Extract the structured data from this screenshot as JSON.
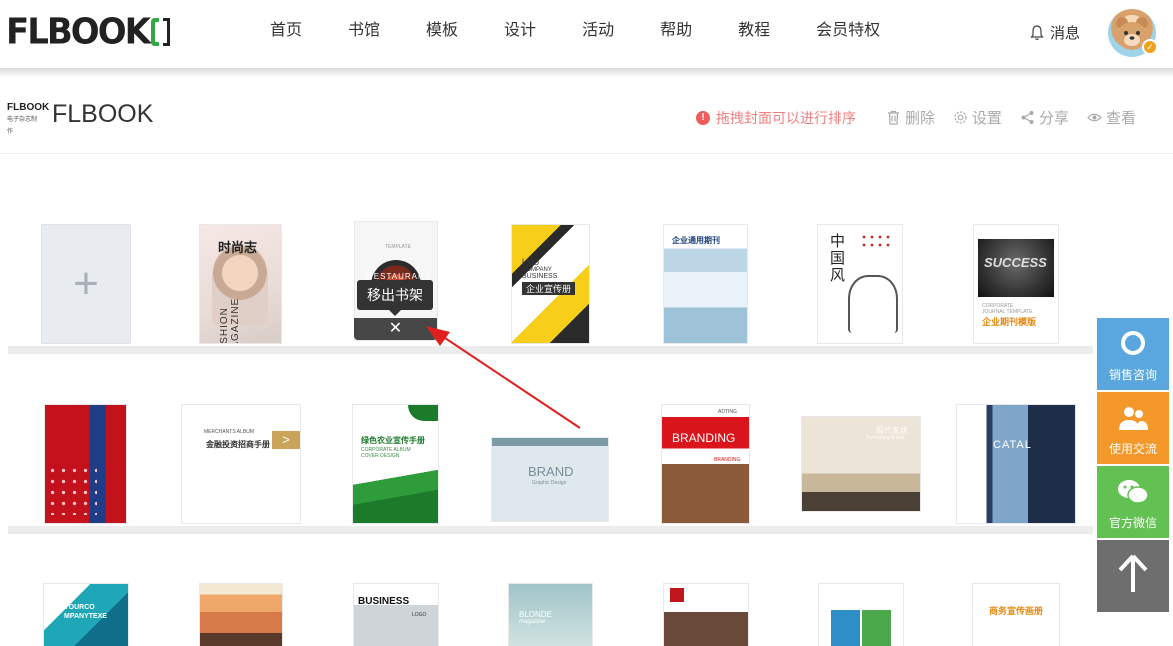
{
  "brand": {
    "logo_text": "FLBOOK"
  },
  "nav": {
    "items": [
      "首页",
      "书馆",
      "模板",
      "设计",
      "活动",
      "帮助",
      "教程",
      "会员特权"
    ]
  },
  "header_right": {
    "message_label": "消息"
  },
  "shelf_header": {
    "mini_logo_text": "FLBOOK",
    "mini_logo_sub": "电子杂志制作",
    "title": "FLBOOK",
    "tip": "拖拽封面可以进行排序",
    "actions": {
      "delete": "删除",
      "settings": "设置",
      "share": "分享",
      "view": "查看"
    }
  },
  "books": {
    "b2": {
      "title": "时尚志",
      "subtitle": "FASHION MAGAZINE"
    },
    "b3": {
      "label": "RESTAURANT",
      "tiny": "TEMPLATE"
    },
    "b4": {
      "l1": "logo",
      "l2": "COMPANY",
      "l3": "BUSINESS",
      "l4": "企业宣传册"
    },
    "b5": {
      "title": "企业通用期刊"
    },
    "b6": {
      "title": "中国风"
    },
    "b7": {
      "title": "SUCCESS",
      "sub1": "CORPORATE",
      "sub2": "JOURNAL TEMPLATE",
      "sub3": "企业期刊模版"
    },
    "r2b2": {
      "l1": "MERCHANTS ALBUM",
      "l2": "金融投资招商手册"
    },
    "r2b3": {
      "l1": "绿色农业宣传手册",
      "l2": "CORPORATE ALBUM",
      "l3": "COVER DESIGN"
    },
    "r2b4": {
      "l1": "BRAND",
      "l2": "Graphic Design"
    },
    "r2b5": {
      "l1": "ADTING",
      "l2": "BRANDING",
      "l3": "BRANDING"
    },
    "r2b6": {
      "l1": "现代家居",
      "l2": "Furnishing Brand"
    },
    "r2b7": {
      "l1": "CATAL"
    },
    "r3b1": {
      "l1": "YOURCO",
      "l2": "MPANYTEXE"
    },
    "r3b3": {
      "l1": "BUSINESS",
      "l2": "LOGO"
    },
    "r3b4": {
      "l1": "BLONDE",
      "l2": "magazine"
    },
    "r3b7": {
      "l1": "商务宣传画册"
    }
  },
  "tooltip": {
    "text": "移出书架",
    "close": "✕"
  },
  "side_panel": {
    "sales": "销售咨询",
    "community": "使用交流",
    "wechat": "官方微信"
  },
  "colors": {
    "accent_green": "#35a640",
    "tip_red": "#ef5c5c",
    "side_blue": "#5aa7e0",
    "side_orange": "#f4982a",
    "side_green": "#63c052"
  }
}
